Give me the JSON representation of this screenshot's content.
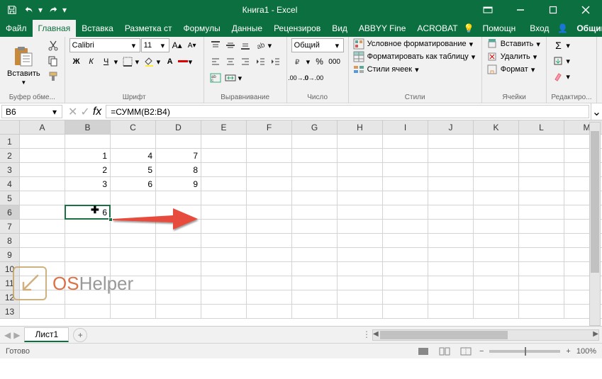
{
  "title": "Книга1 - Excel",
  "qat": {
    "save": "save",
    "undo": "undo",
    "redo": "redo"
  },
  "win": {
    "ribbonOpts": "ribbon-options",
    "min": "minimize",
    "max": "maximize",
    "close": "close"
  },
  "tabs": {
    "file": "Файл",
    "home": "Главная",
    "insert": "Вставка",
    "layout": "Разметка ст",
    "formulas": "Формулы",
    "data": "Данные",
    "review": "Рецензиров",
    "view": "Вид",
    "abbyy": "ABBYY Fine",
    "acrobat": "ACROBAT",
    "help": "Помощн",
    "signin": "Вход",
    "share": "Общий доступ"
  },
  "ribbon": {
    "clipboard": {
      "label": "Буфер обме...",
      "paste": "Вставить"
    },
    "font": {
      "label": "Шрифт",
      "name": "Calibri",
      "size": "11",
      "bold": "Ж",
      "italic": "К",
      "underline": "Ч"
    },
    "alignment": {
      "label": "Выравнивание"
    },
    "number": {
      "label": "Число",
      "format": "Общий"
    },
    "styles": {
      "label": "Стили",
      "cond": "Условное форматирование",
      "table": "Форматировать как таблицу",
      "cell": "Стили ячеек"
    },
    "cells": {
      "label": "Ячейки",
      "insert": "Вставить",
      "delete": "Удалить",
      "format": "Формат"
    },
    "editing": {
      "label": "Редактиро..."
    }
  },
  "namebox": "B6",
  "formula": "=СУММ(B2:B4)",
  "columns": [
    "A",
    "B",
    "C",
    "D",
    "E",
    "F",
    "G",
    "H",
    "I",
    "J",
    "K",
    "L",
    "M"
  ],
  "rows": [
    "1",
    "2",
    "3",
    "4",
    "5",
    "6",
    "7",
    "8",
    "9",
    "10",
    "11",
    "12",
    "13"
  ],
  "cells": {
    "B2": "1",
    "C2": "4",
    "D2": "7",
    "B3": "2",
    "C3": "5",
    "D3": "8",
    "B4": "3",
    "C4": "6",
    "D4": "9",
    "B6": "6"
  },
  "selected": {
    "col": 1,
    "row": 5
  },
  "sheet": {
    "name": "Лист1"
  },
  "status": {
    "ready": "Готово",
    "zoom": "100%"
  },
  "oshelper": {
    "os": "OS",
    "helper": "Helper"
  }
}
